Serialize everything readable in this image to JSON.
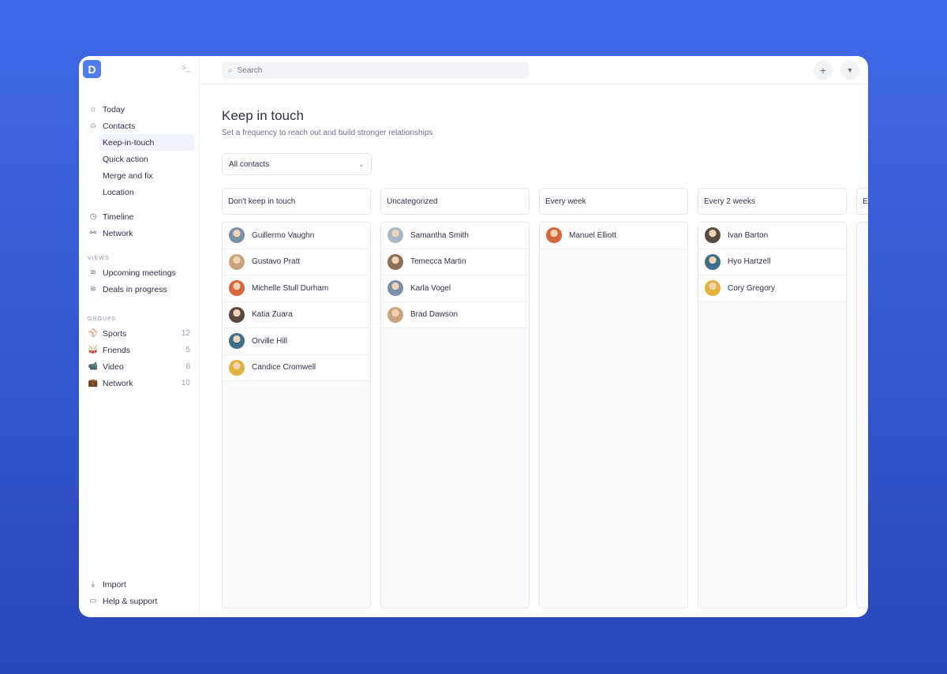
{
  "sidebar": {
    "logo": "D",
    "collapse_icon": "terminal-icon",
    "nav": [
      {
        "label": "Today",
        "icon": "☼"
      },
      {
        "label": "Contacts",
        "icon": "⍝"
      }
    ],
    "contacts_sub": [
      {
        "label": "Keep-in-touch",
        "active": true
      },
      {
        "label": "Quick action"
      },
      {
        "label": "Merge and fix"
      },
      {
        "label": "Location"
      }
    ],
    "nav2": [
      {
        "label": "Timeline",
        "icon": "◷"
      },
      {
        "label": "Network",
        "icon": "⚯"
      }
    ],
    "views_title": "VIEWS",
    "views": [
      {
        "label": "Upcoming meetings"
      },
      {
        "label": "Deals in progress"
      }
    ],
    "groups_title": "GROUPS",
    "groups": [
      {
        "label": "Sports",
        "emoji": "⚾",
        "count": "12"
      },
      {
        "label": "Friends",
        "emoji": "🥁",
        "count": "5"
      },
      {
        "label": "Video",
        "emoji": "📹",
        "count": "8"
      },
      {
        "label": "Network",
        "emoji": "💼",
        "count": "10"
      }
    ],
    "footer": [
      {
        "label": "Import",
        "icon": "⤓"
      },
      {
        "label": "Help & support",
        "icon": "▭"
      }
    ]
  },
  "topbar": {
    "search_placeholder": "Search"
  },
  "page": {
    "title": "Keep in touch",
    "subtitle": "Set a frequency to reach out and build stronger relationships",
    "filter": "All contacts"
  },
  "columns": [
    {
      "title": "Don't keep in touch",
      "contacts": [
        "Guillermo Vaughn",
        "Gustavo Pratt",
        "Michelle Stull Durham",
        "Katia Zuara",
        "Orville Hill",
        "Candice Cromwell"
      ]
    },
    {
      "title": "Uncategorized",
      "contacts": [
        "Samantha Smith",
        "Temecca Martin",
        "Karla Vogel",
        "Brad Dawson"
      ]
    },
    {
      "title": "Every week",
      "contacts": [
        "Manuel Elliott"
      ]
    },
    {
      "title": "Every 2 weeks",
      "contacts": [
        "Ivan Barton",
        "Hyo Hartzell",
        "Cory Gregory"
      ]
    },
    {
      "title": "Every month",
      "contacts": []
    }
  ],
  "colors": {
    "accent": "#4d7cf3",
    "background": "#3f6ae6",
    "active_bg": "#eff3fd"
  }
}
